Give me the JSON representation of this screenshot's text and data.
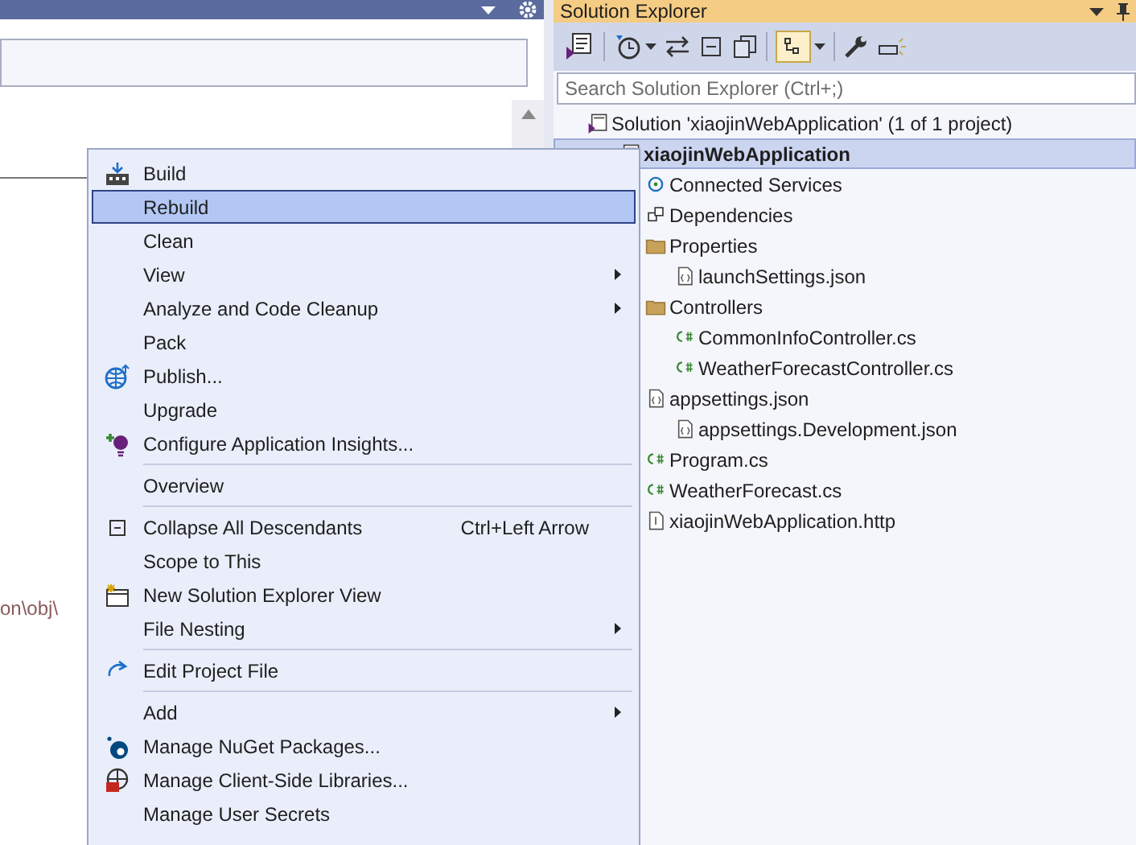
{
  "left_panel": {
    "output_fragment": "on\\obj\\"
  },
  "solution_explorer": {
    "title": "Solution Explorer",
    "search": {
      "placeholder": "Search Solution Explorer (Ctrl+;)"
    },
    "tree": [
      {
        "label": "Solution 'xiaojinWebApplication' (1 of 1 project)",
        "selected": false,
        "children": [
          {
            "label": "xiaojinWebApplication",
            "selected": true,
            "children": [
              {
                "label": "Connected Services",
                "selected": false
              },
              {
                "label": "Dependencies",
                "selected": false
              },
              {
                "label": "Properties",
                "selected": false,
                "children": [
                  {
                    "label": "launchSettings.json",
                    "selected": false
                  }
                ]
              },
              {
                "label": "Controllers",
                "selected": false,
                "children": [
                  {
                    "label": "CommonInfoController.cs",
                    "selected": false
                  },
                  {
                    "label": "WeatherForecastController.cs",
                    "selected": false
                  }
                ]
              },
              {
                "label": "appsettings.json",
                "selected": false,
                "children": [
                  {
                    "label": "appsettings.Development.json",
                    "selected": false
                  }
                ]
              },
              {
                "label": "Program.cs",
                "selected": false
              },
              {
                "label": "WeatherForecast.cs",
                "selected": false
              },
              {
                "label": "xiaojinWebApplication.http",
                "selected": false
              }
            ]
          }
        ]
      }
    ]
  },
  "context_menu": [
    {
      "kind": "item",
      "label": "Build",
      "selected": false,
      "submenu": false
    },
    {
      "kind": "item",
      "label": "Rebuild",
      "selected": true,
      "submenu": false
    },
    {
      "kind": "item",
      "label": "Clean",
      "selected": false,
      "submenu": false
    },
    {
      "kind": "item",
      "label": "View",
      "selected": false,
      "submenu": true
    },
    {
      "kind": "item",
      "label": "Analyze and Code Cleanup",
      "selected": false,
      "submenu": true
    },
    {
      "kind": "item",
      "label": "Pack",
      "selected": false,
      "submenu": false
    },
    {
      "kind": "item",
      "label": "Publish...",
      "selected": false,
      "submenu": false
    },
    {
      "kind": "item",
      "label": "Upgrade",
      "selected": false,
      "submenu": false
    },
    {
      "kind": "item",
      "label": "Configure Application Insights...",
      "selected": false,
      "submenu": false
    },
    {
      "kind": "separator"
    },
    {
      "kind": "item",
      "label": "Overview",
      "selected": false,
      "submenu": false
    },
    {
      "kind": "separator"
    },
    {
      "kind": "item",
      "label": "Collapse All Descendants",
      "shortcut": "Ctrl+Left Arrow",
      "selected": false,
      "submenu": false
    },
    {
      "kind": "item",
      "label": "Scope to This",
      "selected": false,
      "submenu": false
    },
    {
      "kind": "item",
      "label": "New Solution Explorer View",
      "selected": false,
      "submenu": false
    },
    {
      "kind": "item",
      "label": "File Nesting",
      "selected": false,
      "submenu": true
    },
    {
      "kind": "separator"
    },
    {
      "kind": "item",
      "label": "Edit Project File",
      "selected": false,
      "submenu": false
    },
    {
      "kind": "separator"
    },
    {
      "kind": "item",
      "label": "Add",
      "selected": false,
      "submenu": true
    },
    {
      "kind": "item",
      "label": "Manage NuGet Packages...",
      "selected": false,
      "submenu": false
    },
    {
      "kind": "item",
      "label": "Manage Client-Side Libraries...",
      "selected": false,
      "submenu": false
    },
    {
      "kind": "item",
      "label": "Manage User Secrets",
      "selected": false,
      "submenu": false
    }
  ]
}
